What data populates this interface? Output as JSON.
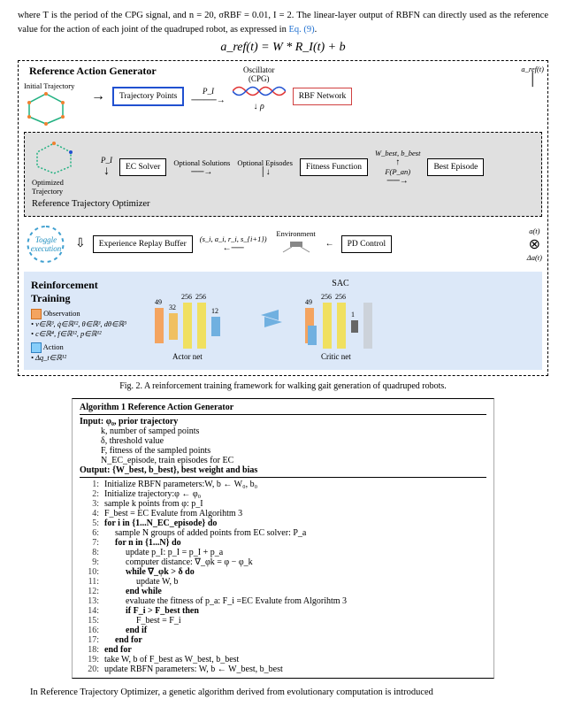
{
  "top_text": "where T is the period of the CPG signal, and n = 20, σRBF = 0.01, I = 2. The linear-layer output of RBFN can directly used as the reference value for the action of each joint of the quadruped robot, as expressed in ",
  "eq_link": "Eq. (9)",
  "equation": "a_ref(t) = W * R_I(t) + b",
  "ref_gen_title": "Reference Action Generator",
  "initial_traj": "Initial Trajectory",
  "traj_points": "Trajectory Points",
  "oscillator": "Oscillator",
  "cpg": "(CPG)",
  "rho": "ρ",
  "rbf_network": "RBF Network",
  "aref": "a_ref(t)",
  "traj_opt_title": "Reference Trajectory Optimizer",
  "optimized_traj": "Optimized Trajectory",
  "p_i": "P_I",
  "ec_solver": "EC Solver",
  "optional_sols": "Optional Solutions",
  "optional_eps": "Optional Episodes",
  "fitness_fn": "Fitness Function",
  "wb_best": "W_best, b_best",
  "fp": "F(P_an)",
  "best_ep": "Best Episode",
  "toggle": "Toggle execution",
  "replay": "Experience Replay Buffer",
  "tuple": "(s_i, a_i, r_i, s_{i+1})",
  "env": "Environment",
  "pd": "PD Control",
  "at": "a(t)",
  "da": "Δa(t)",
  "reinf_title": "Reinforcement Training",
  "obs_label": "Observation",
  "obs_items": "• v∈ℝ³, q̇∈ℝ¹², θ∈ℝ³, dθ∈ℝ³",
  "obs_items2": "• c∈ℝ⁴, f∈ℝ¹², p∈ℝ¹²",
  "act_label": "Action",
  "act_items": "• Δq_t∈ℝ¹²",
  "sac": "SAC",
  "actor": "Actor net",
  "critic": "Critic net",
  "n49": "49",
  "n32": "32",
  "n256": "256",
  "n12": "12",
  "n1": "1",
  "fig_caption": "Fig. 2. A reinforcement training framework for walking gait generation of quadruped robots.",
  "algo": {
    "title": "Algorithm 1 Reference Action Generator",
    "input": "Input: φ₀, prior trajectory",
    "in1": "k, number of samped points",
    "in2": "δ, threshold value",
    "in3": "F, fitness of the sampled points",
    "in4": "N_EC_episode, train episodes for EC",
    "output": "Output: {W_best, b_best}, best weight and bias",
    "l1": "Initialize RBFN parameters:W, b ← W₀, b₀",
    "l2": "Initialize trajectory:φ ← φ₀",
    "l3": "sample k points from φ: p_I",
    "l4": "F_best = EC Evalute from Algorihtm 3",
    "l5": "for i in {1...N_EC_episode} do",
    "l6": "sample N groups of added points from EC solver: P_a",
    "l7": "for n in {1...N} do",
    "l8": "update p_I: p_I = p_I + p_a",
    "l9": "computer distance: ∇_φk = φ − φ_k",
    "l10": "while ∇_φk > δ do",
    "l11": "update W, b",
    "l12": "end while",
    "l13": "evaluate the fitness of p_a: F_i =EC Evalute from Algorihtm 3",
    "l14": "if F_i > F_best then",
    "l15": "F_best = F_i",
    "l16": "end if",
    "l17": "end for",
    "l18": "end for",
    "l19": "take W, b of F_best as W_best, b_best",
    "l20": "update RBFN parameters: W, b ← W_best, b_best"
  },
  "bot_text": "In Reference Trajectory Optimizer, a genetic algorithm derived from evolutionary computation is introduced"
}
